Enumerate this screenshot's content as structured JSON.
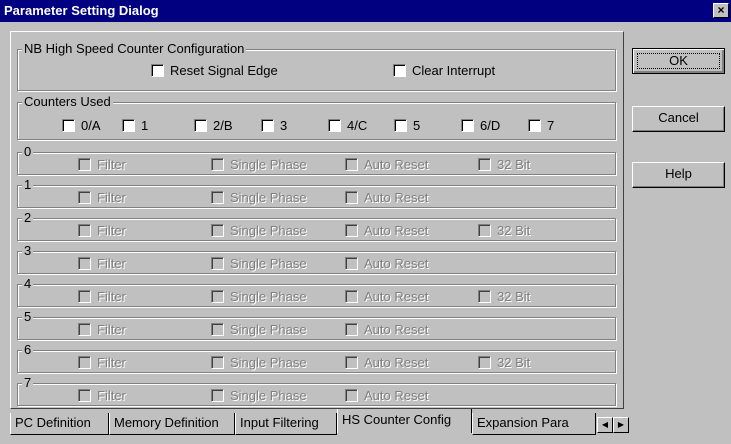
{
  "window": {
    "title": "Parameter Setting Dialog",
    "close_glyph": "×"
  },
  "config_group": {
    "label": "NB High Speed Counter Configuration",
    "options": [
      "Reset Signal Edge",
      "Clear Interrupt"
    ]
  },
  "counters_used": {
    "label": "Counters Used",
    "items": [
      "0/A",
      "1",
      "2/B",
      "3",
      "4/C",
      "5",
      "6/D",
      "7"
    ]
  },
  "counter_groups": [
    {
      "label": "0",
      "options": [
        "Filter",
        "Single Phase",
        "Auto Reset",
        "32 Bit"
      ]
    },
    {
      "label": "1",
      "options": [
        "Filter",
        "Single Phase",
        "Auto Reset"
      ]
    },
    {
      "label": "2",
      "options": [
        "Filter",
        "Single Phase",
        "Auto Reset",
        "32 Bit"
      ]
    },
    {
      "label": "3",
      "options": [
        "Filter",
        "Single Phase",
        "Auto Reset"
      ]
    },
    {
      "label": "4",
      "options": [
        "Filter",
        "Single Phase",
        "Auto Reset",
        "32 Bit"
      ]
    },
    {
      "label": "5",
      "options": [
        "Filter",
        "Single Phase",
        "Auto Reset"
      ]
    },
    {
      "label": "6",
      "options": [
        "Filter",
        "Single Phase",
        "Auto Reset",
        "32 Bit"
      ]
    },
    {
      "label": "7",
      "options": [
        "Filter",
        "Single Phase",
        "Auto Reset"
      ]
    }
  ],
  "buttons": {
    "ok": "OK",
    "cancel": "Cancel",
    "help": "Help"
  },
  "tabs": [
    "PC Definition",
    "Memory Definition",
    "Input Filtering",
    "HS Counter Config",
    "Expansion Para"
  ],
  "active_tab": "HS Counter Config",
  "tab_scroll": {
    "left_glyph": "◀",
    "right_glyph": "▶"
  }
}
